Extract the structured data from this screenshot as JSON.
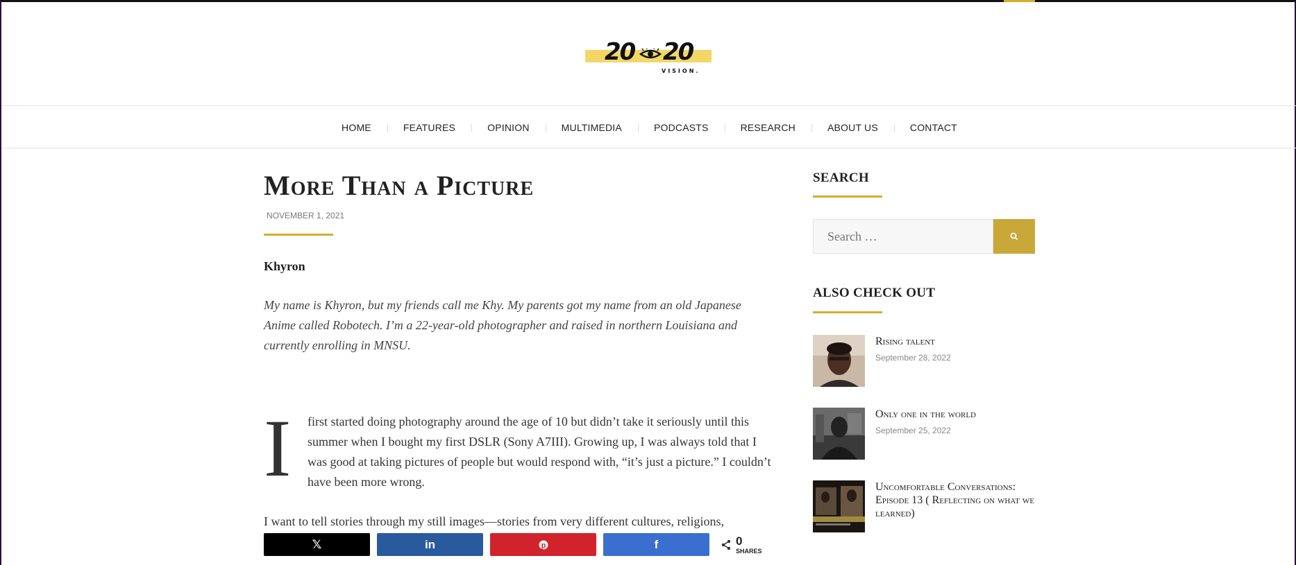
{
  "site": {
    "logo_left": "20",
    "logo_right": "20",
    "logo_sub": "VISION.",
    "accent_color": "#d4ad2f"
  },
  "nav": {
    "items": [
      "HOME",
      "FEATURES",
      "OPINION",
      "MULTIMEDIA",
      "PODCASTS",
      "RESEARCH",
      "ABOUT US",
      "CONTACT"
    ]
  },
  "post": {
    "title": "More Than a Picture",
    "date": "NOVEMBER 1, 2021",
    "author": "Khyron",
    "intro": "My name is Khyron, but my friends call me Khy. My parents got my name from an old Japanese Anime called Robotech. I’m a 22-year-old photographer and raised in northern Louisiana and currently enrolling in MNSU.",
    "dropcap": "I",
    "para1": "first started doing photography around the age of 10 but didn’t take it seriously until this summer when I bought my first DSLR (Sony A7III). Growing up, I was always told that I was good at taking pictures of people but would respond with, “it’s just a picture.” I couldn’t have been more wrong.",
    "para2": "I want to tell stories through my still images—stories from very different cultures, religions,"
  },
  "share": {
    "count": "0",
    "label": "SHARES",
    "x_icon": "x-logo-icon",
    "linkedin_icon": "linkedin-icon",
    "pinterest_icon": "pinterest-icon",
    "facebook_icon": "facebook-icon"
  },
  "sidebar": {
    "search_title": "SEARCH",
    "search_placeholder": "Search …",
    "also_title": "ALSO CHECK OUT",
    "posts": [
      {
        "title": "Rising talent",
        "date": "September 28, 2022"
      },
      {
        "title": "Only one in the world",
        "date": "September 25, 2022"
      },
      {
        "title": "Uncomfortable Conversations: Episode 13 ( Reflecting on what we learned)",
        "date": ""
      }
    ]
  }
}
